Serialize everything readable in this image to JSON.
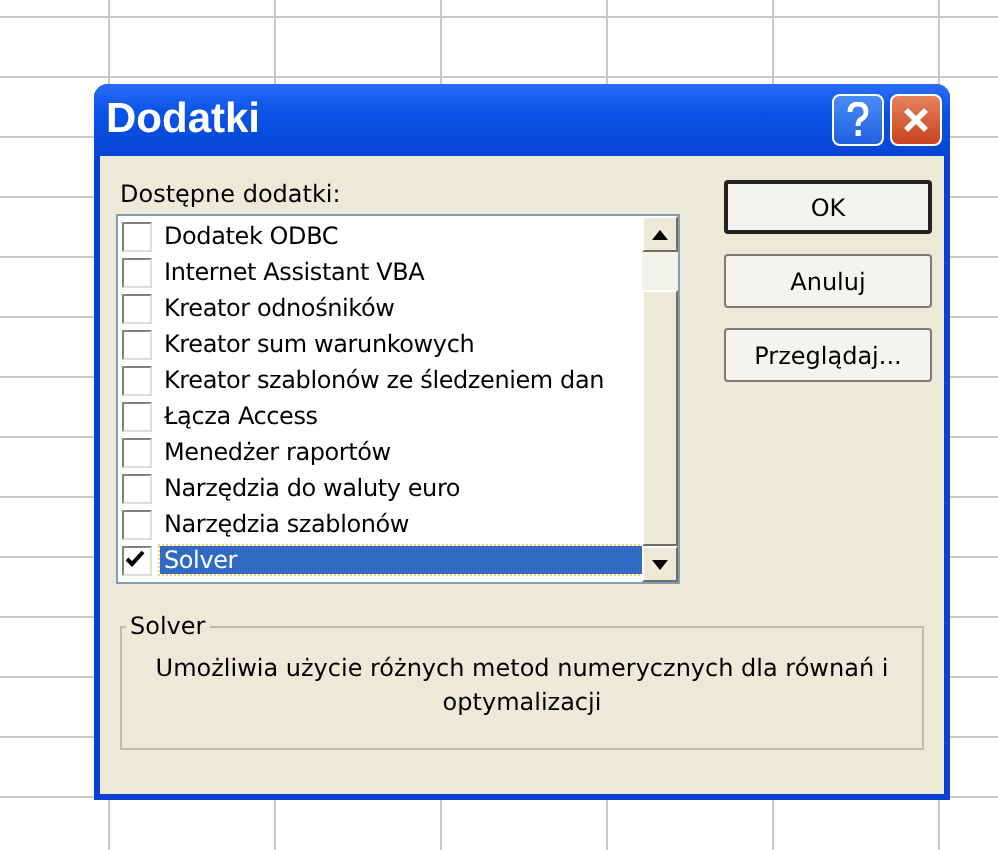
{
  "window": {
    "title": "Dodatki"
  },
  "list": {
    "label": "Dostępne dodatki:",
    "items": [
      {
        "label": "Dodatek ODBC",
        "checked": false,
        "selected": false
      },
      {
        "label": "Internet Assistant VBA",
        "checked": false,
        "selected": false
      },
      {
        "label": "Kreator odnośników",
        "checked": false,
        "selected": false
      },
      {
        "label": "Kreator sum warunkowych",
        "checked": false,
        "selected": false
      },
      {
        "label": "Kreator szablonów ze śledzeniem dan",
        "checked": false,
        "selected": false
      },
      {
        "label": "Łącza Access",
        "checked": false,
        "selected": false
      },
      {
        "label": "Menedżer raportów",
        "checked": false,
        "selected": false
      },
      {
        "label": "Narzędzia do waluty euro",
        "checked": false,
        "selected": false
      },
      {
        "label": "Narzędzia szablonów",
        "checked": false,
        "selected": false
      },
      {
        "label": "Solver",
        "checked": true,
        "selected": true
      }
    ]
  },
  "buttons": [
    {
      "label": "OK",
      "default": true
    },
    {
      "label": "Anuluj",
      "default": false
    },
    {
      "label": "Przeglądaj...",
      "default": false
    }
  ],
  "description": {
    "title": "Solver",
    "text": "Umożliwia użycie różnych metod numerycznych dla równań i optymalizacji"
  }
}
